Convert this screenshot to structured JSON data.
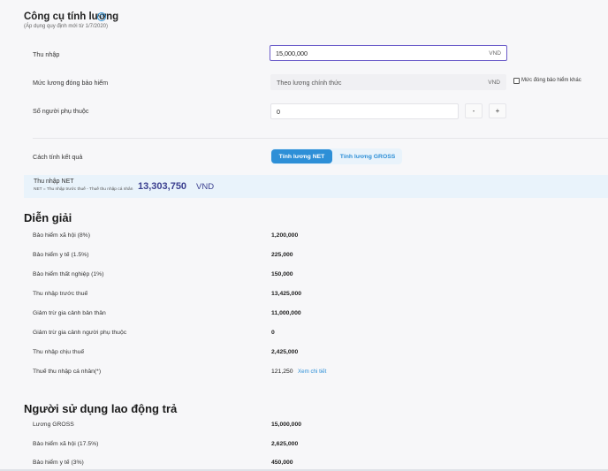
{
  "header": {
    "title": "Công cụ tính lương",
    "help_icon": "?",
    "subtitle": "(Áp dụng quy định mới từ 1/7/2020)"
  },
  "form": {
    "income": {
      "label": "Thu nhập",
      "value": "15,000,000",
      "unit": "VND"
    },
    "insurance_salary": {
      "label": "Mức lương đóng bảo hiểm",
      "value": "Theo lương chính thức",
      "unit": "VND",
      "other_checkbox_label": "Mức đóng bảo hiểm khác",
      "other_checked": false
    },
    "dependents": {
      "label": "Số người phụ thuộc",
      "value": "0",
      "minus": "-",
      "plus": "+"
    },
    "calc_mode": {
      "label": "Cách tính kết quả",
      "net_label": "Tính lương NET",
      "gross_label": "Tính lương GROSS",
      "selected": "net"
    }
  },
  "result": {
    "label": "Thu nhập NET",
    "formula": "NET = Thu nhập trước thuế - Thuế thu nhập cá nhân",
    "amount": "13,303,750",
    "unit": "VND"
  },
  "explanation": {
    "heading": "Diễn giải",
    "rows": [
      {
        "label": "Bảo hiểm xã hội (8%)",
        "value": "1,200,000"
      },
      {
        "label": "Bảo hiểm y tế (1.5%)",
        "value": "225,000"
      },
      {
        "label": "Bảo hiểm thất nghiệp (1%)",
        "value": "150,000"
      },
      {
        "label": "Thu nhập trước thuế",
        "value": "13,425,000"
      },
      {
        "label": "Giảm trừ gia cảnh bản thân",
        "value": "11,000,000"
      },
      {
        "label": "Giảm trừ gia cảnh người phụ thuộc",
        "value": "0"
      },
      {
        "label": "Thu nhập chịu thuế",
        "value": "2,425,000"
      },
      {
        "label": "Thuế thu nhập cá nhân(*)",
        "value": "121,250",
        "link": "Xem chi tiết"
      }
    ]
  },
  "employer": {
    "heading": "Người sử dụng lao động trả",
    "rows": [
      {
        "label": "Lương GROSS",
        "value": "15,000,000"
      },
      {
        "label": "Bảo hiểm xã hội (17.5%)",
        "value": "2,625,000"
      },
      {
        "label": "Bảo hiểm y tế (3%)",
        "value": "450,000"
      }
    ]
  },
  "colors": {
    "accent": "#2d8fd7",
    "result_text": "#3b3f8f",
    "result_bg": "#e9f3fb",
    "active_border": "#6b5cc9"
  }
}
